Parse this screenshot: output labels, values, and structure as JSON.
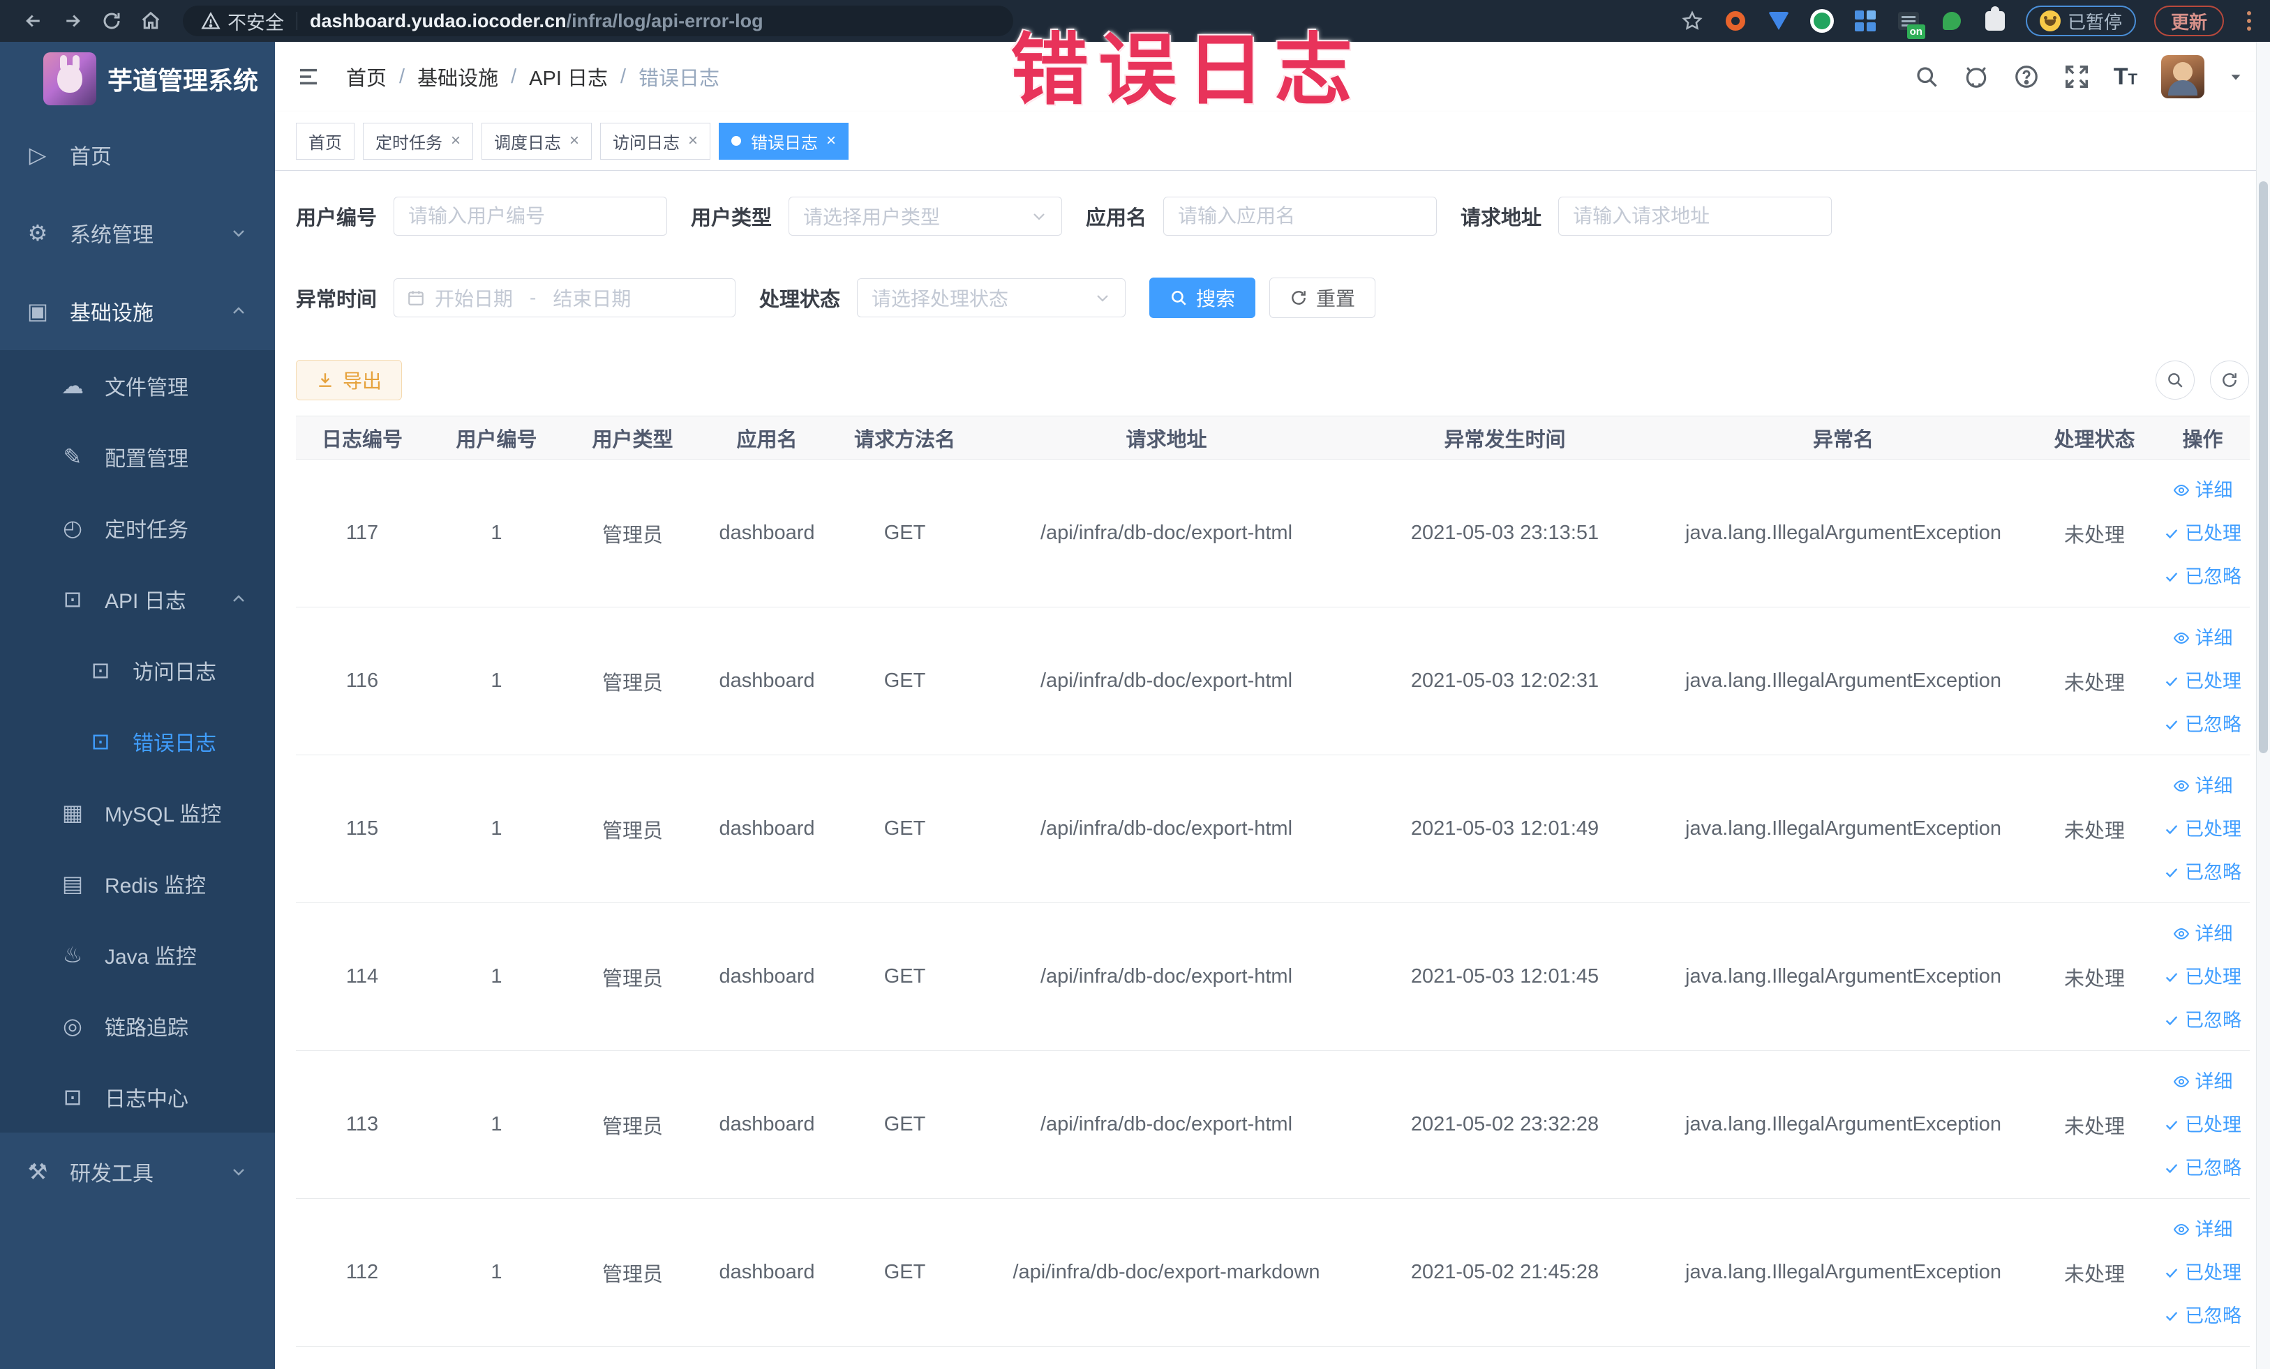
{
  "watermark": {
    "text": "错误日志",
    "color": "#e8335a"
  },
  "browser": {
    "security_label": "不安全",
    "url_domain": "dashboard.yudao.iocoder.cn",
    "url_path": "/infra/log/api-error-log",
    "proxy_badge": "on",
    "paused_label": "已暂停",
    "update_label": "更新"
  },
  "sidebar": {
    "logo_title": "芋道管理系统",
    "items": {
      "home": "首页",
      "system": "系统管理",
      "infra": "基础设施",
      "file": "文件管理",
      "config": "配置管理",
      "job": "定时任务",
      "api_log": "API 日志",
      "access_log": "访问日志",
      "error_log": "错误日志",
      "mysql": "MySQL 监控",
      "redis": "Redis 监控",
      "java": "Java 监控",
      "trace": "链路追踪",
      "log_center": "日志中心",
      "dev_tools": "研发工具"
    }
  },
  "topbar": {
    "breadcrumb": [
      "首页",
      "基础设施",
      "API 日志",
      "错误日志"
    ]
  },
  "tags": [
    "首页",
    "定时任务",
    "调度日志",
    "访问日志",
    "错误日志"
  ],
  "filter": {
    "user_id_label": "用户编号",
    "user_id_placeholder": "请输入用户编号",
    "user_type_label": "用户类型",
    "user_type_placeholder": "请选择用户类型",
    "app_name_label": "应用名",
    "app_name_placeholder": "请输入应用名",
    "request_url_label": "请求地址",
    "request_url_placeholder": "请输入请求地址",
    "exception_time_label": "异常时间",
    "start_date_placeholder": "开始日期",
    "range_separator": "-",
    "end_date_placeholder": "结束日期",
    "process_status_label": "处理状态",
    "process_status_placeholder": "请选择处理状态",
    "search_label": "搜索",
    "reset_label": "重置"
  },
  "toolbar": {
    "export_label": "导出"
  },
  "table": {
    "columns": [
      "日志编号",
      "用户编号",
      "用户类型",
      "应用名",
      "请求方法名",
      "请求地址",
      "异常发生时间",
      "异常名",
      "处理状态",
      "操作"
    ],
    "actions": {
      "detail": "详细",
      "processed": "已处理",
      "ignored": "已忽略"
    },
    "rows": [
      {
        "id": "117",
        "user_id": "1",
        "user_type": "管理员",
        "app": "dashboard",
        "method": "GET",
        "url": "/api/infra/db-doc/export-html",
        "time": "2021-05-03 23:13:51",
        "exception": "java.lang.IllegalArgumentException",
        "status": "未处理"
      },
      {
        "id": "116",
        "user_id": "1",
        "user_type": "管理员",
        "app": "dashboard",
        "method": "GET",
        "url": "/api/infra/db-doc/export-html",
        "time": "2021-05-03 12:02:31",
        "exception": "java.lang.IllegalArgumentException",
        "status": "未处理"
      },
      {
        "id": "115",
        "user_id": "1",
        "user_type": "管理员",
        "app": "dashboard",
        "method": "GET",
        "url": "/api/infra/db-doc/export-html",
        "time": "2021-05-03 12:01:49",
        "exception": "java.lang.IllegalArgumentException",
        "status": "未处理"
      },
      {
        "id": "114",
        "user_id": "1",
        "user_type": "管理员",
        "app": "dashboard",
        "method": "GET",
        "url": "/api/infra/db-doc/export-html",
        "time": "2021-05-03 12:01:45",
        "exception": "java.lang.IllegalArgumentException",
        "status": "未处理"
      },
      {
        "id": "113",
        "user_id": "1",
        "user_type": "管理员",
        "app": "dashboard",
        "method": "GET",
        "url": "/api/infra/db-doc/export-html",
        "time": "2021-05-02 23:32:28",
        "exception": "java.lang.IllegalArgumentException",
        "status": "未处理"
      },
      {
        "id": "112",
        "user_id": "1",
        "user_type": "管理员",
        "app": "dashboard",
        "method": "GET",
        "url": "/api/infra/db-doc/export-markdown",
        "time": "2021-05-02 21:45:28",
        "exception": "java.lang.IllegalArgumentException",
        "status": "未处理"
      }
    ]
  }
}
